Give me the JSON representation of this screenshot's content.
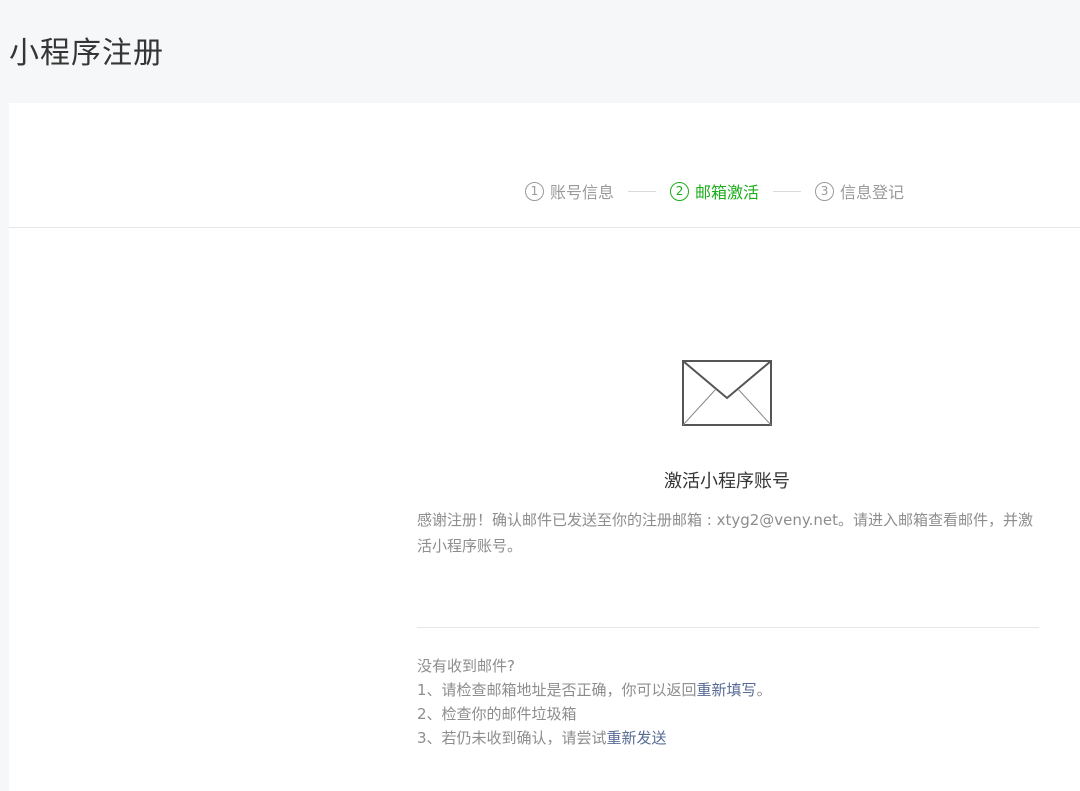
{
  "header": {
    "title": "小程序注册"
  },
  "steps": [
    {
      "num": "1",
      "label": "账号信息"
    },
    {
      "num": "2",
      "label": "邮箱激活"
    },
    {
      "num": "3",
      "label": "信息登记"
    }
  ],
  "main": {
    "title": "激活小程序账号",
    "desc_before": "感谢注册！确认邮件已发送至你的注册邮箱 : ",
    "email": "xtyg2@veny.net",
    "desc_after": "。请进入邮箱查看邮件，并激活小程序账号。"
  },
  "help": {
    "title": "没有收到邮件?",
    "item1_prefix": "1、请检查邮箱地址是否正确，你可以返回",
    "item1_link": "重新填写",
    "item1_suffix": "。",
    "item2": "2、检查你的邮件垃圾箱",
    "item3_prefix": "3、若仍未收到确认，请尝试",
    "item3_link": "重新发送"
  },
  "colors": {
    "active": "#1aad19",
    "link": "#576b95",
    "muted": "#8d8d8d"
  }
}
